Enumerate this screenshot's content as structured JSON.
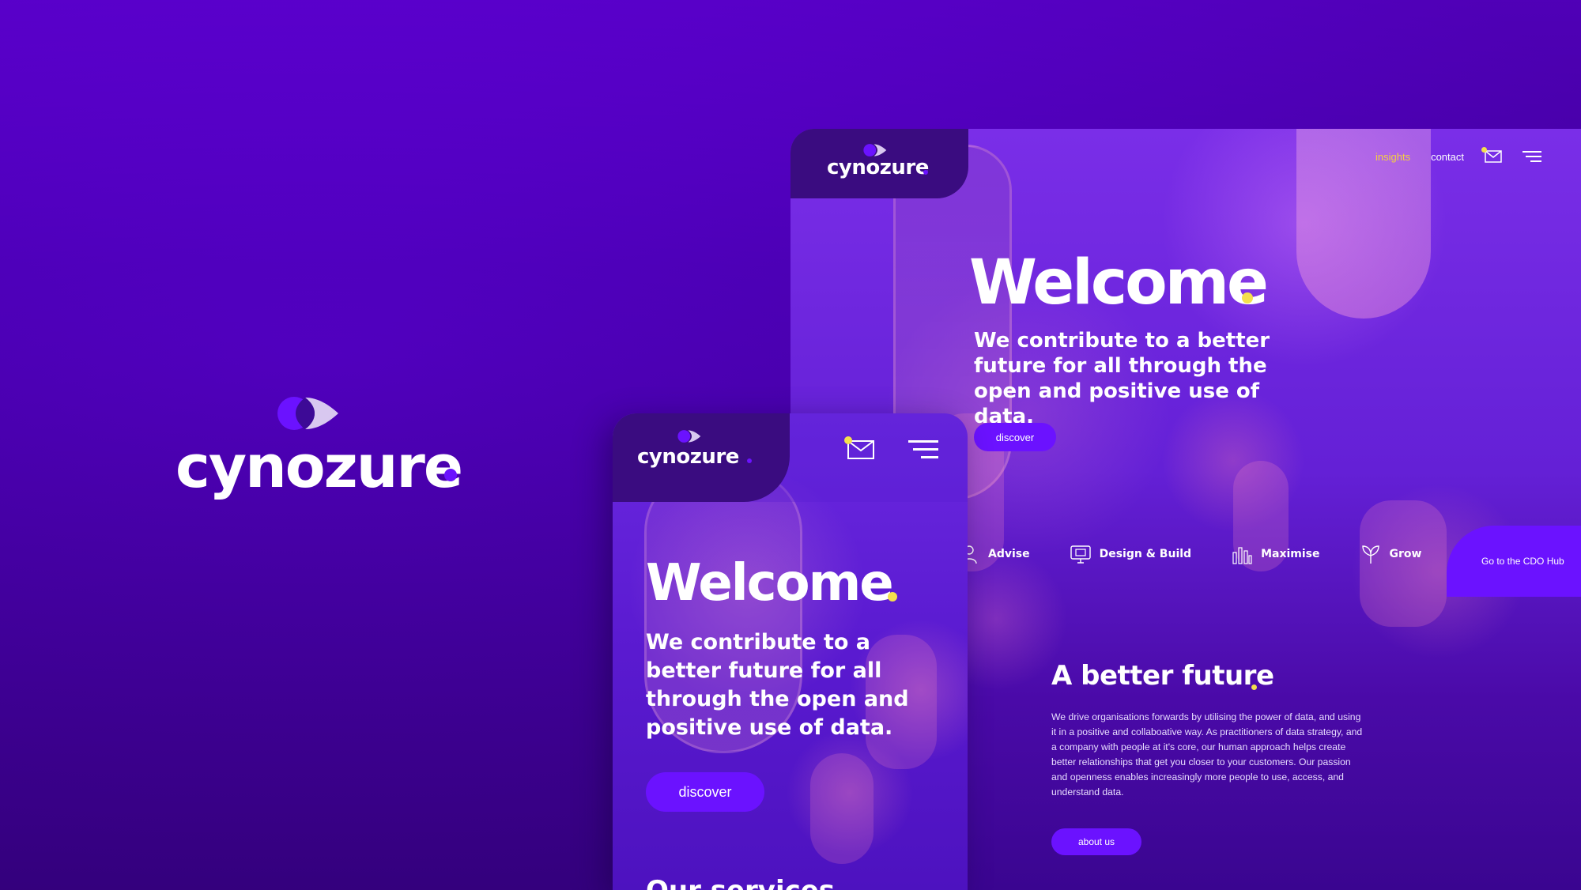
{
  "brand": {
    "name": "cynozure",
    "colors": {
      "primary": "#6b12ff",
      "accent": "#f4e04d",
      "dark": "#3a0c80"
    }
  },
  "desktop": {
    "nav": {
      "insights": "insights",
      "contact": "contact",
      "mail_icon": "mail-icon",
      "menu_icon": "hamburger-menu-icon"
    },
    "hero": {
      "title": "Welcome",
      "tagline": "We contribute to a better future for all through the open and positive use of data.",
      "cta": "discover"
    },
    "services": [
      {
        "label": "Advise",
        "icon": "person-icon"
      },
      {
        "label": "Design & Build",
        "icon": "monitor-icon"
      },
      {
        "label": "Maximise",
        "icon": "bar-chart-icon"
      },
      {
        "label": "Grow",
        "icon": "leaf-icon"
      }
    ],
    "cdo_hub": "Go to the CDO Hub",
    "about": {
      "title": "A better future",
      "body": "We drive organisations forwards by utilising the power of data, and using it in a positive and collaboative way. As practitioners of data strategy, and a company with people at it's core, our human approach helps create better relationships that get you closer to your customers. Our passion and openness enables increasingly more people to use, access, and understand data.",
      "cta": "about us"
    }
  },
  "mobile": {
    "hero": {
      "title": "Welcome",
      "tagline": "We contribute to a better future for all through the open and positive use of data.",
      "cta": "discover"
    },
    "services_title": "Our services"
  }
}
